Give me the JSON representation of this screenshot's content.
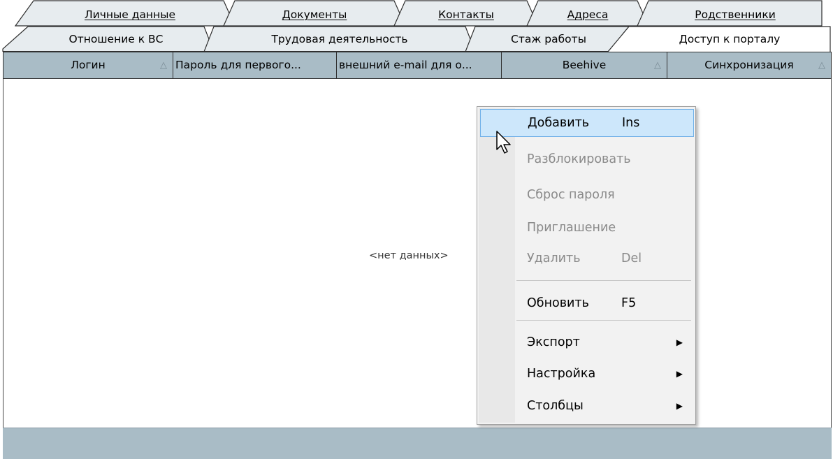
{
  "tabs": {
    "row1": [
      "Личные данные",
      "Документы",
      "Контакты",
      "Адреса",
      "Родственники"
    ],
    "row2": [
      "Отношение к ВС",
      "Трудовая деятельность",
      "Стаж работы",
      "Доступ к порталу"
    ],
    "active": "Доступ к порталу"
  },
  "grid": {
    "columns": [
      "Логин",
      "Пароль для первого...",
      "внешний e-mail для о...",
      "Beehive",
      "Синхронизация"
    ],
    "sort_glyph": "△",
    "empty_text": "<нет данных>"
  },
  "context_menu": {
    "items": [
      {
        "label": "Добавить",
        "shortcut": "Ins",
        "enabled": true,
        "highlighted": true
      },
      {
        "label": "Разблокировать",
        "shortcut": "",
        "enabled": false
      },
      {
        "label": "Сброс пароля",
        "shortcut": "",
        "enabled": false
      },
      {
        "label": "Приглашение",
        "shortcut": "",
        "enabled": false
      },
      {
        "label": "Удалить",
        "shortcut": "Del",
        "enabled": false
      },
      {
        "label": "Обновить",
        "shortcut": "F5",
        "enabled": true
      },
      {
        "label": "Экспорт",
        "submenu": true,
        "enabled": true
      },
      {
        "label": "Настройка",
        "submenu": true,
        "enabled": true
      },
      {
        "label": "Столбцы",
        "submenu": true,
        "enabled": true
      }
    ],
    "submenu_icon": "triangle-right-icon"
  },
  "colors": {
    "header_bg": "#a9bcc6",
    "tab_bg": "#e7ecef",
    "menu_bg": "#f2f2f2",
    "highlight_bg": "#cde7fb",
    "highlight_border": "#70b0e8"
  }
}
